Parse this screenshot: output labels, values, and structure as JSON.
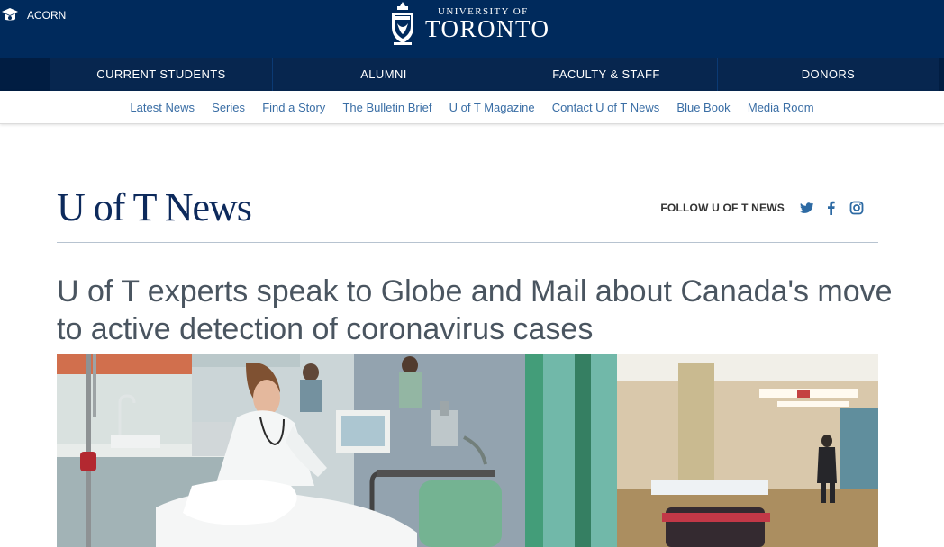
{
  "topbar": {
    "acorn_label": "ACORN",
    "logo_line1": "UNIVERSITY OF",
    "logo_line2": "TORONTO"
  },
  "audience_nav": [
    {
      "label": "CURRENT STUDENTS"
    },
    {
      "label": "ALUMNI"
    },
    {
      "label": "FACULTY & STAFF"
    },
    {
      "label": "DONORS"
    }
  ],
  "sub_nav": [
    {
      "label": "Latest News"
    },
    {
      "label": "Series"
    },
    {
      "label": "Find a Story"
    },
    {
      "label": "The Bulletin Brief"
    },
    {
      "label": "U of T Magazine"
    },
    {
      "label": "Contact U of T News"
    },
    {
      "label": "Blue Book"
    },
    {
      "label": "Media Room"
    }
  ],
  "masthead": {
    "title": "U of T News",
    "follow_label": "FOLLOW U OF T NEWS",
    "social": [
      "twitter-icon",
      "facebook-icon",
      "instagram-icon"
    ]
  },
  "article": {
    "headline": "U of T experts speak to Globe and Mail about Canada's move to active detection of coronavirus cases",
    "hero_alt": "Nurse attending to a patient in a hospital emergency department"
  },
  "colors": {
    "navy": "#002a5c",
    "nav_dark": "#011d42",
    "link": "#3a6ea5",
    "headline": "#4a5560"
  }
}
